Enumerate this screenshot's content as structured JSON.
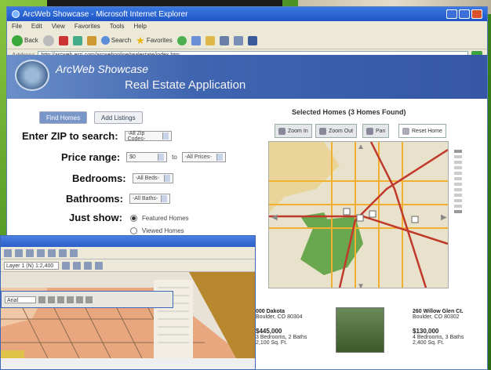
{
  "browser": {
    "title": "ArcWeb Showcase - Microsoft Internet Explorer",
    "menu": [
      "File",
      "Edit",
      "View",
      "Favorites",
      "Tools",
      "Help"
    ],
    "toolbar": {
      "back_label": "Back",
      "search_label": "Search",
      "favorites_label": "Favorites"
    },
    "address": {
      "label": "Address",
      "url": "http://arcweb.esri.com/arcwebonline/realestate/index.htm"
    }
  },
  "app": {
    "name": "ArcWeb Showcase",
    "subtitle": "Real Estate Application"
  },
  "tabs": {
    "find_homes": "Find Homes",
    "add_listings": "Add Listings"
  },
  "form": {
    "zip_label": "Enter ZIP to search:",
    "zip_value": "-All Zip Codes-",
    "price_label": "Price range:",
    "price_min": "$0",
    "price_to": "to",
    "price_max": "-All Prices-",
    "bedrooms_label": "Bedrooms:",
    "bedrooms_value": "-All Beds-",
    "bathrooms_label": "Bathrooms:",
    "bathrooms_value": "-All Baths-",
    "just_show_label": "Just show:",
    "option_featured": "Featured Homes",
    "option_viewed": "Viewed Homes"
  },
  "map": {
    "title": "Selected Homes (3 Homes Found)",
    "tools": {
      "zoom_in": "Zoom In",
      "zoom_out": "Zoom Out",
      "pan": "Pan",
      "reset": "Reset Home"
    }
  },
  "results": [
    {
      "address": "000 Dakota",
      "city": "Boulder, CO 80304",
      "price": "$445,000",
      "details": "3 Bedrooms, 2 Baths",
      "size": "2,100 Sq. Ft."
    },
    {
      "address": "260 Willow Glen Ct.",
      "city": "Boulder, CO 80302",
      "price": "$130,000",
      "details": "4 Bedrooms, 3 Baths",
      "size": "2,400 Sq. Ft."
    }
  ],
  "gis": {
    "combo1": "Layer 1 (N) 1:2,400",
    "combo2": "Arial"
  }
}
